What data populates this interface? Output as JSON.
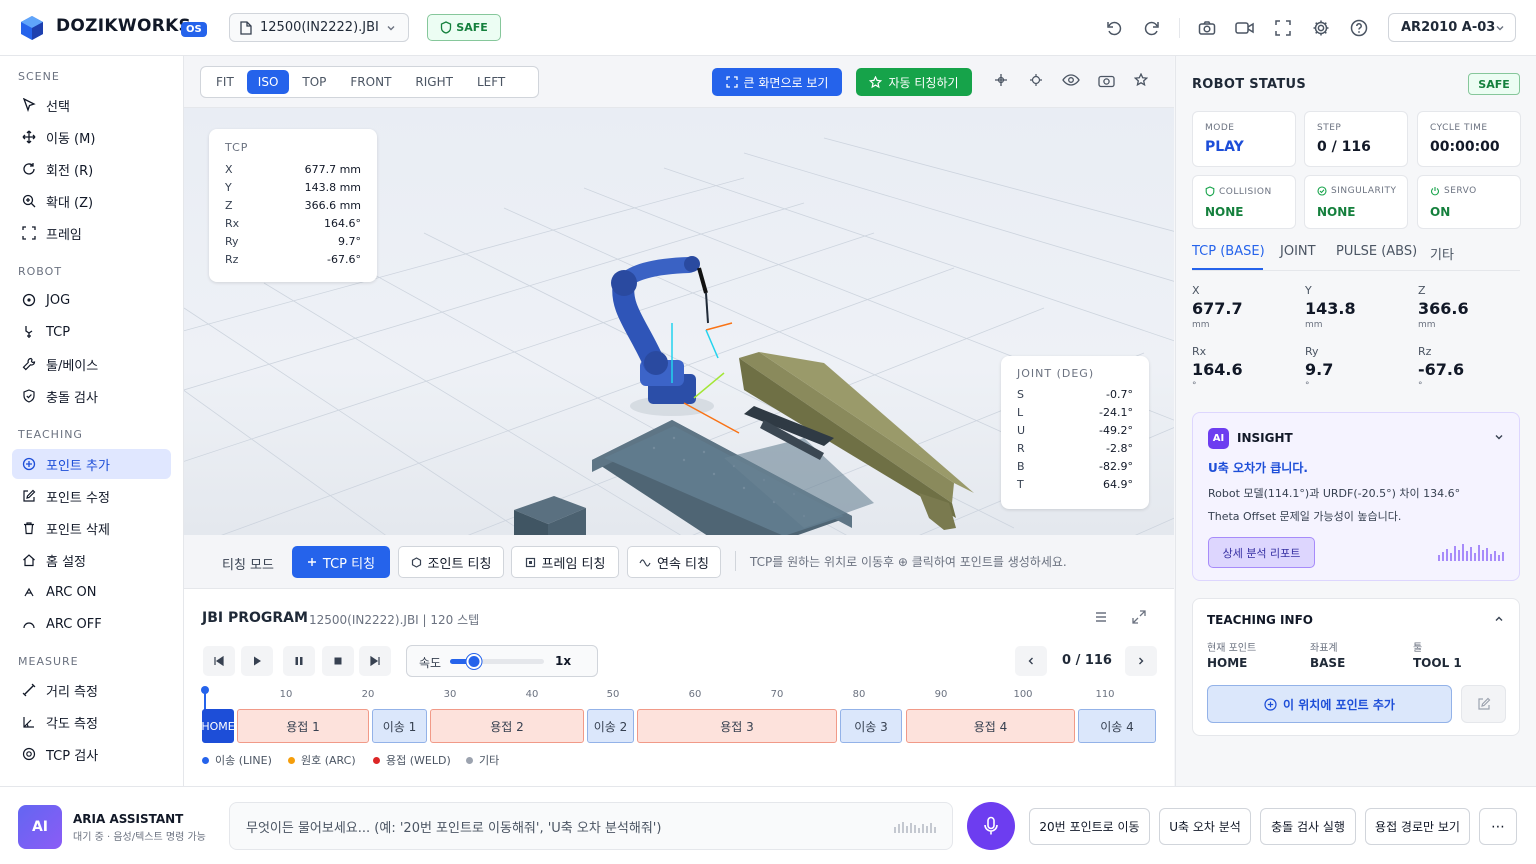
{
  "header": {
    "app_name": "DOZIKWORKS",
    "os_badge": "OS",
    "file_name": "12500(IN2222).JBI",
    "safe_label": "SAFE",
    "robot_model": "AR2010 A-03"
  },
  "sidebar": {
    "sections": {
      "scene": "SCENE",
      "robot": "ROBOT",
      "teaching": "TEACHING",
      "measure": "MEASURE"
    },
    "scene_items": [
      "선택",
      "이동 (M)",
      "회전 (R)",
      "확대 (Z)",
      "프레임"
    ],
    "robot_items": [
      "JOG",
      "TCP",
      "툴/베이스",
      "충돌 검사"
    ],
    "teaching_items": [
      "포인트 추가",
      "포인트 수정",
      "포인트 삭제",
      "홈 설정",
      "ARC ON",
      "ARC OFF"
    ],
    "measure_items": [
      "거리 측정",
      "각도 측정",
      "TCP 검사"
    ]
  },
  "viewbar": {
    "tabs": [
      "FIT",
      "ISO",
      "TOP",
      "FRONT",
      "RIGHT",
      "LEFT"
    ],
    "active_tab": "ISO",
    "fullscreen_label": "큰 화면으로 보기",
    "auto_teach_label": "자동 티칭하기"
  },
  "tcp_panel": {
    "title": "TCP",
    "rows": [
      {
        "k": "X",
        "v": "677.7 mm"
      },
      {
        "k": "Y",
        "v": "143.8 mm"
      },
      {
        "k": "Z",
        "v": "366.6 mm"
      },
      {
        "k": "Rx",
        "v": "164.6°"
      },
      {
        "k": "Ry",
        "v": "9.7°"
      },
      {
        "k": "Rz",
        "v": "-67.6°"
      }
    ]
  },
  "joint_panel": {
    "title": "JOINT (DEG)",
    "rows": [
      {
        "k": "S",
        "v": "-0.7°"
      },
      {
        "k": "L",
        "v": "-24.1°"
      },
      {
        "k": "U",
        "v": "-49.2°"
      },
      {
        "k": "R",
        "v": "-2.8°"
      },
      {
        "k": "B",
        "v": "-82.9°"
      },
      {
        "k": "T",
        "v": "64.9°"
      }
    ]
  },
  "teach_bar": {
    "mode_label": "티칭 모드",
    "buttons": [
      "TCP 티칭",
      "조인트 티칭",
      "프레임 티칭",
      "연속 티칭"
    ],
    "hint": "TCP를 원하는 위치로 이동후 ⊕ 클릭하여 포인트를 생성하세요."
  },
  "program": {
    "title": "JBI PROGRAM",
    "subtitle": "12500(IN2222).JBI | 120 스텝",
    "speed_label": "속도",
    "speed_value": "1x",
    "speed_fraction": 0.25,
    "step_display": "0 / 116",
    "ticks": [
      "10",
      "20",
      "30",
      "40",
      "50",
      "60",
      "70",
      "80",
      "90",
      "100",
      "110"
    ],
    "segments": [
      {
        "label": "HOME",
        "type": "home"
      },
      {
        "label": "용접 1",
        "type": "weld"
      },
      {
        "label": "이송 1",
        "type": "move"
      },
      {
        "label": "용접 2",
        "type": "weld"
      },
      {
        "label": "이송 2",
        "type": "move"
      },
      {
        "label": "용접 3",
        "type": "weld"
      },
      {
        "label": "이송 3",
        "type": "move"
      },
      {
        "label": "용접 4",
        "type": "weld"
      },
      {
        "label": "이송 4",
        "type": "move"
      }
    ],
    "legend": [
      {
        "label": "이송 (LINE)",
        "color": "#2563eb"
      },
      {
        "label": "원호 (ARC)",
        "color": "#f59e0b"
      },
      {
        "label": "용접 (WELD)",
        "color": "#dc2626"
      },
      {
        "label": "기타",
        "color": "#9ca3af"
      }
    ]
  },
  "robot_status": {
    "title": "ROBOT STATUS",
    "safe_label": "SAFE",
    "mode_label": "MODE",
    "mode_value": "PLAY",
    "step_label": "STEP",
    "step_value": "0 / 116",
    "cycle_label": "CYCLE TIME",
    "cycle_value": "00:00:00",
    "collision_label": "COLLISION",
    "collision_value": "NONE",
    "singularity_label": "SINGULARITY",
    "singularity_value": "NONE",
    "servo_label": "SERVO",
    "servo_value": "ON",
    "tabs": [
      "TCP (BASE)",
      "JOINT",
      "PULSE (ABS)",
      "기타"
    ],
    "coords": [
      {
        "label": "X",
        "value": "677.7",
        "unit": "mm"
      },
      {
        "label": "Y",
        "value": "143.8",
        "unit": "mm"
      },
      {
        "label": "Z",
        "value": "366.6",
        "unit": "mm"
      },
      {
        "label": "Rx",
        "value": "164.6",
        "unit": "°"
      },
      {
        "label": "Ry",
        "value": "9.7",
        "unit": "°"
      },
      {
        "label": "Rz",
        "value": "-67.6",
        "unit": "°"
      }
    ]
  },
  "insight": {
    "badge": "AI",
    "title": "INSIGHT",
    "headline_strong": "U축 오차가 큽니다.",
    "line1": "Robot 모델(114.1°)과 URDF(-20.5°) 차이 134.6°",
    "line2": "Theta Offset 문제일 가능성이 높습니다.",
    "report_button": "상세 분석 리포트"
  },
  "teaching_info": {
    "title": "TEACHING INFO",
    "current_point_label": "현재 포인트",
    "current_point_value": "HOME",
    "coord_sys_label": "좌표계",
    "coord_sys_value": "BASE",
    "tool_label": "툴",
    "tool_value": "TOOL 1",
    "add_button": "이 위치에 포인트 추가"
  },
  "assistant": {
    "avatar": "AI",
    "name": "ARIA ASSISTANT",
    "status": "대기 중 · 음성/텍스트 명령 가능",
    "placeholder": "무엇이든 물어보세요... (예: '20번 포인트로 이동해줘', 'U축 오차 분석해줘')",
    "quick_actions": [
      "20번 포인트로 이동",
      "U축 오차 분석",
      "충돌 검사 실행",
      "용접 경로만 보기"
    ],
    "more": "⋯"
  }
}
